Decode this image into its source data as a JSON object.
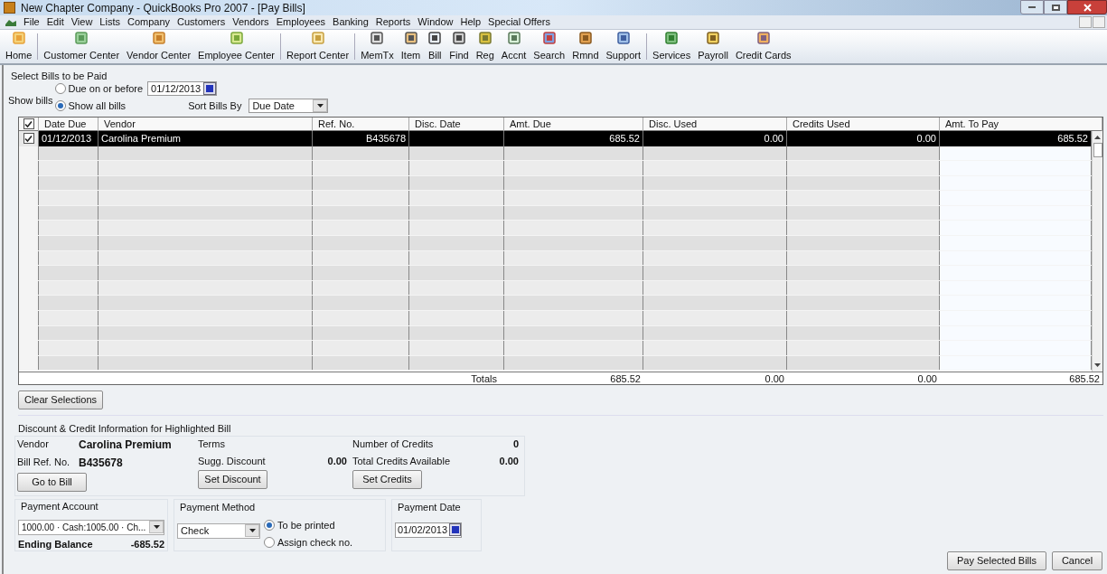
{
  "window": {
    "title": "New Chapter Company - QuickBooks Pro 2007 - [Pay Bills]"
  },
  "menu": [
    "File",
    "Edit",
    "View",
    "Lists",
    "Company",
    "Customers",
    "Vendors",
    "Employees",
    "Banking",
    "Reports",
    "Window",
    "Help",
    "Special Offers"
  ],
  "toolbar": [
    {
      "label": "Home",
      "kind": "home",
      "group_start": false
    },
    {
      "label": "Customer Center",
      "kind": "customer",
      "group_start": true
    },
    {
      "label": "Vendor Center",
      "kind": "vendor",
      "group_start": false
    },
    {
      "label": "Employee Center",
      "kind": "employee",
      "group_start": false
    },
    {
      "label": "Report Center",
      "kind": "report",
      "group_start": true
    },
    {
      "label": "MemTx",
      "kind": "memtx",
      "group_start": true
    },
    {
      "label": "Item",
      "kind": "item",
      "group_start": false
    },
    {
      "label": "Bill",
      "kind": "bill",
      "group_start": false
    },
    {
      "label": "Find",
      "kind": "find",
      "group_start": false
    },
    {
      "label": "Reg",
      "kind": "reg",
      "group_start": false
    },
    {
      "label": "Accnt",
      "kind": "accnt",
      "group_start": false
    },
    {
      "label": "Search",
      "kind": "search",
      "group_start": false
    },
    {
      "label": "Rmnd",
      "kind": "rmnd",
      "group_start": false
    },
    {
      "label": "Support",
      "kind": "support",
      "group_start": false
    },
    {
      "label": "Services",
      "kind": "services",
      "group_start": true
    },
    {
      "label": "Payroll",
      "kind": "payroll",
      "group_start": false
    },
    {
      "label": "Credit Cards",
      "kind": "cards",
      "group_start": false
    }
  ],
  "select_section": {
    "title": "Select Bills to be Paid",
    "show_bills_label": "Show bills",
    "options": [
      {
        "label": "Due on or before",
        "selected": false
      },
      {
        "label": "Show all bills",
        "selected": true
      }
    ],
    "due_date": "01/12/2013",
    "sort_label": "Sort Bills By",
    "sort_value": "Due Date"
  },
  "table": {
    "all_checked": true,
    "columns": [
      "Date Due",
      "Vendor",
      "Ref. No.",
      "Disc. Date",
      "Amt. Due",
      "Disc. Used",
      "Credits Used",
      "Amt. To Pay"
    ],
    "rows": [
      {
        "checked": true,
        "selected": true,
        "cells": [
          "01/12/2013",
          "Carolina Premium",
          "B435678",
          "",
          "685.52",
          "0.00",
          "0.00",
          "685.52"
        ]
      }
    ],
    "totals_label": "Totals",
    "totals": [
      "685.52",
      "0.00",
      "0.00",
      "685.52"
    ]
  },
  "clear_button": "Clear Selections",
  "discount_section": {
    "title": "Discount & Credit Information for Highlighted Bill",
    "vendor_label": "Vendor",
    "vendor": "Carolina Premium",
    "ref_label": "Bill Ref. No.",
    "ref": "B435678",
    "terms_label": "Terms",
    "sugg_label": "Sugg. Discount",
    "sugg": "0.00",
    "credits_count_label": "Number of Credits",
    "credits_count": "0",
    "credits_total_label": "Total Credits Available",
    "credits_total": "0.00",
    "buttons": [
      "Go to Bill",
      "Set Discount",
      "Set Credits"
    ]
  },
  "payment_account": {
    "title": "Payment Account",
    "value": "1000.00 · Cash:1005.00 · Ch...",
    "balance_label": "Ending Balance",
    "balance": "-685.52"
  },
  "payment_method": {
    "title": "Payment Method",
    "value": "Check",
    "options": [
      {
        "label": "To be printed",
        "selected": true
      },
      {
        "label": "Assign check no.",
        "selected": false
      }
    ]
  },
  "payment_date": {
    "title": "Payment Date",
    "value": "01/02/2013"
  },
  "footer_buttons": [
    "Pay Selected Bills",
    "Cancel"
  ]
}
